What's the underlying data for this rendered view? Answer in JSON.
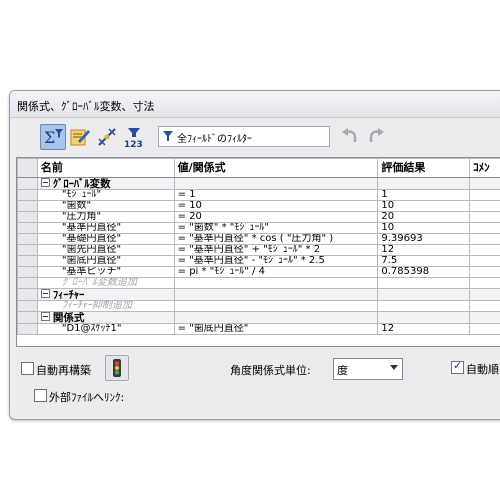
{
  "dialog": {
    "title": "関係式、ｸﾞﾛｰﾊﾞﾙ変数、寸法"
  },
  "toolbar": {
    "buttons": [
      {
        "icon": "sigma-filter-icon"
      },
      {
        "icon": "edit-equations-icon"
      },
      {
        "icon": "dimension-view-icon"
      },
      {
        "icon": "ordered-view-icon"
      }
    ],
    "filter": {
      "icon": "filter-icon",
      "text": "全ﾌｨｰﾙﾄﾞのﾌｨﾙﾀｰ"
    },
    "undo_icon": "undo-icon",
    "redo_icon": "redo-icon"
  },
  "table": {
    "headers": [
      "名前",
      "値/関係式",
      "評価結果",
      "ｺﾒﾝ"
    ],
    "groups": [
      {
        "label": "ｸﾞﾛｰﾊﾞﾙ変数",
        "rows": [
          {
            "name": "\"ﾓｼﾞｭｰﾙ\"",
            "value": "= 1",
            "result": "1"
          },
          {
            "name": "\"歯数\"",
            "value": "= 10",
            "result": "10"
          },
          {
            "name": "\"圧力角\"",
            "value": "= 20",
            "result": "20"
          },
          {
            "name": "\"基準円直径\"",
            "value": "= \"歯数\" * \"ﾓｼﾞｭｰﾙ\"",
            "result": "10"
          },
          {
            "name": "\"基礎円直径\"",
            "value": "= \"基準円直径\" * cos ( \"圧力角\" )",
            "result": "9.39693"
          },
          {
            "name": "\"歯先円直径\"",
            "value": "= \"基準円直径\" + \"ﾓｼﾞｭｰﾙ\" * 2",
            "result": "12"
          },
          {
            "name": "\"歯底円直径\"",
            "value": "= \"基準円直径\" - \"ﾓｼﾞｭｰﾙ\" * 2.5",
            "result": "7.5"
          },
          {
            "name": "\"基準ピッチ\"",
            "value": "= pi * \"ﾓｼﾞｭｰﾙ\" / 4",
            "result": "0.785398"
          }
        ],
        "add_placeholder": "ｸﾞﾛｰﾊﾞﾙ変数追加"
      },
      {
        "label": "ﾌｨｰﾁｬｰ",
        "rows": [],
        "add_placeholder": "ﾌｨｰﾁｬｰ抑制追加"
      },
      {
        "label": "関係式",
        "rows": [
          {
            "name": "\"D1@ｽｹｯﾁ1\"",
            "value": "= \"歯底円直径\"",
            "result": "12"
          }
        ]
      }
    ]
  },
  "bottom": {
    "auto_rebuild_label": "自動再構築",
    "traffic_light_icon": "traffic-light-icon",
    "angle_unit_label": "角度関係式単位:",
    "angle_unit_value": "度",
    "auto_sort_label": "自動順",
    "external_link_label": "外部ﾌｧｲﾙへﾘﾝｸ:"
  }
}
